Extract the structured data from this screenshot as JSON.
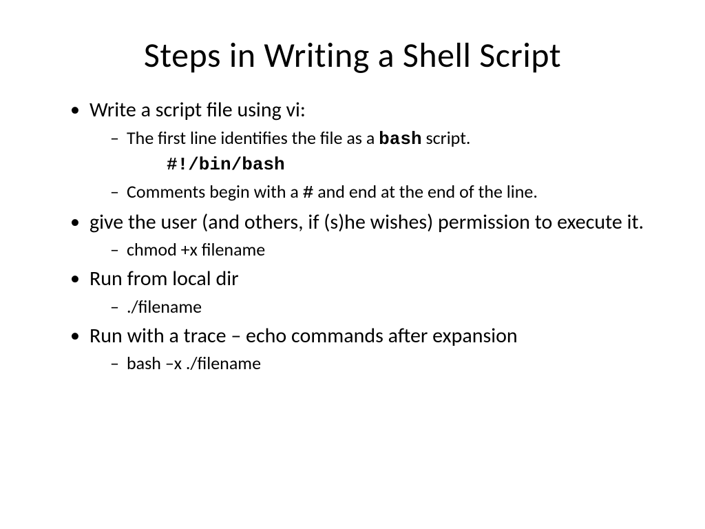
{
  "title": "Steps in Writing a Shell Script",
  "bullets": [
    {
      "text": "Write a script file using vi:",
      "sub": [
        {
          "prefix": "The first line identifies the file as a ",
          "mono": "bash",
          "suffix": " script."
        },
        {
          "code": "#!/bin/bash"
        },
        {
          "prefix": "Comments begin with a ",
          "mono": "#",
          "suffix": " and end at the end of the line."
        }
      ]
    },
    {
      "text": "give the user (and others, if (s)he wishes) permission to execute it.",
      "sub": [
        {
          "plain": "chmod +x filename"
        }
      ]
    },
    {
      "text": "Run from local dir",
      "sub": [
        {
          "plain": "./filename"
        }
      ]
    },
    {
      "text": "Run with a trace – echo commands after expansion",
      "sub": [
        {
          "plain": "bash –x ./filename"
        }
      ]
    }
  ]
}
